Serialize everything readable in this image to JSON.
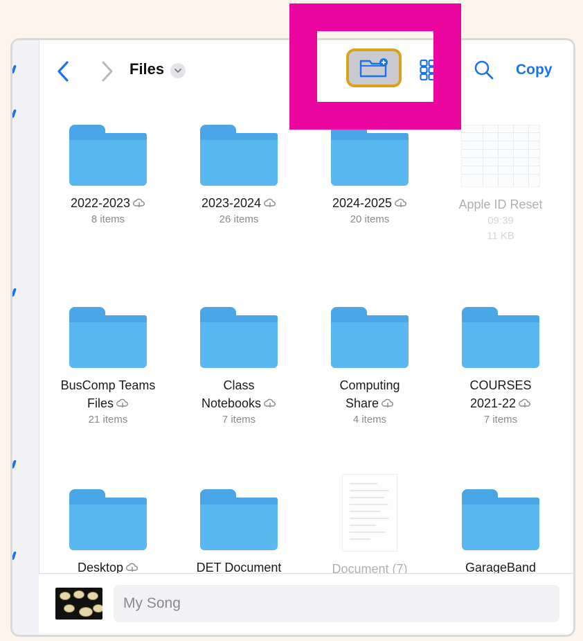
{
  "toolbar": {
    "title": "Files",
    "copy_label": "Copy"
  },
  "items": [
    {
      "name": "2022-2023",
      "sub": "8 items"
    },
    {
      "name": "2023-2024",
      "sub": "26 items"
    },
    {
      "name": "2024-2025",
      "sub": "20 items"
    },
    {
      "name": "Apple ID Reset",
      "sub": "09:39",
      "sub2": "11 KB"
    },
    {
      "name1": "BusComp Teams",
      "name2": "Files",
      "sub": "21 items"
    },
    {
      "name1": "Class",
      "name2": "Notebooks",
      "sub": "7 items"
    },
    {
      "name1": "Computing",
      "name2": "Share",
      "sub": "4 items"
    },
    {
      "name1": "COURSES",
      "name2": "2021-22",
      "sub": "7 items"
    },
    {
      "name": "Desktop"
    },
    {
      "name": "DET Document"
    },
    {
      "name": "Document (7)"
    },
    {
      "name": "GarageBand"
    }
  ],
  "bottom": {
    "song_name": "My Song"
  },
  "icons": {
    "back": "chevron-left-icon",
    "forward": "chevron-right-icon",
    "dropdown": "chevron-down-icon",
    "new_folder": "new-folder-icon",
    "view": "grid-view-icon",
    "search": "search-icon",
    "cloud": "cloud-download-icon"
  },
  "colors": {
    "accent": "#1a73e8",
    "highlight": "#eb06a1",
    "folder": "#5ab8f0",
    "selected_border": "#d8a21a"
  }
}
